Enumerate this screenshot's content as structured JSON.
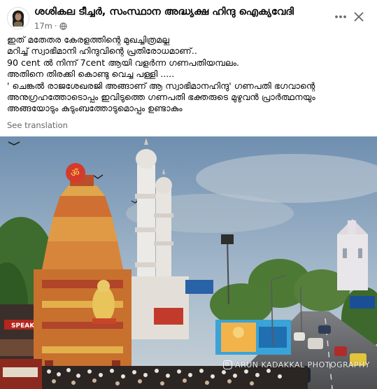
{
  "post": {
    "author": "ശശികല ടീച്ചർ, സംസ്ഥാന അദ്ധ്യക്ഷ ഹിന്ദു ഐക്യവേദി",
    "time": "17m",
    "separator": "·",
    "privacy_icon": "globe-icon",
    "actions": {
      "more_icon": "more-horizontal-icon",
      "close_icon": "close-icon"
    },
    "text_lines": [
      "ഇത് മതേതര കേരളത്തിന്റെ മുഖച്ചിത്രമല്ല",
      "മറിച്ച് സ്വാഭിമാനി ഹിന്ദുവിന്റെ പ്രതിരോധമാണ്..",
      "90 cent ൽ നിന്ന് 7cent ആയി വളർന്ന ഗണപതിയമ്പലം.",
      "അതിനെ തിരക്കി കൊണ്ടു വെച്ച പള്ളി .....",
      "' ചെങ്കൽ രാജശേഖരജി അങ്ങാണ് ആ സ്വാഭിമാനഹിന്ദു' ഗണപതി ഭഗവാന്റെ",
      "അനുഗ്രഹത്തോടൊപ്പം ഇവിടുത്തെ ഗണപതി ഭക്തരുടെ മുഴുവൻ പ്രാർത്ഥനയും",
      "അങ്ങയോടും കുടുംബത്തോടുമൊപ്പം ഉണ്ടാകും"
    ],
    "see_translation": "See translation"
  },
  "photo": {
    "watermark": "ARUN KADAKKAL PHOTOGRAPHY",
    "watermark_icon": "instagram-icon",
    "shop_sign": "SPEAK"
  },
  "colors": {
    "text_primary": "#050505",
    "text_secondary": "#65676b",
    "sky": "#8fa7bd",
    "temple_gopuram": "#c8702e"
  }
}
